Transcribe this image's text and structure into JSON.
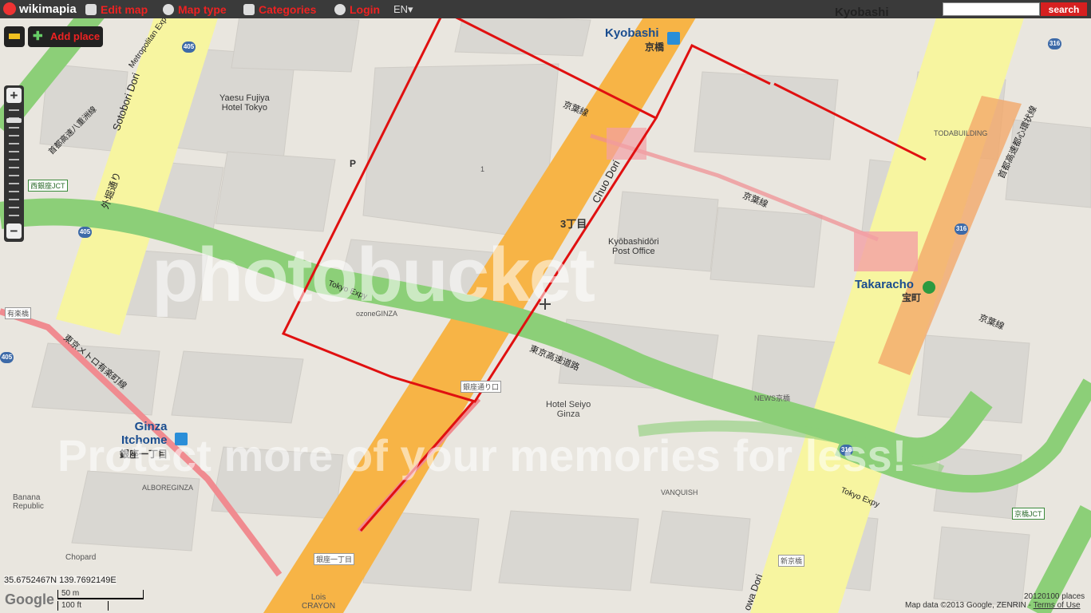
{
  "header": {
    "logo": "wikimapia",
    "edit_map": "Edit map",
    "map_type": "Map type",
    "categories": "Categories",
    "login": "Login",
    "language": "EN▾",
    "current_place": "Kyobashi",
    "search_placeholder": "",
    "search_button": "search"
  },
  "tools": {
    "add_place": "Add place",
    "zoom_in": "+",
    "zoom_out": "−"
  },
  "map": {
    "stations": {
      "kyobashi_en": "Kyobashi",
      "kyobashi_ja": "京橋",
      "takaracho_en": "Takaracho",
      "takaracho_ja": "宝町",
      "ginza_itchome_en": "Ginza\nItchome",
      "ginza_itchome_ja": "銀座一丁目"
    },
    "district": "3丁目",
    "roads": {
      "chuo_dori": "Chuo Dori",
      "sotobori_dori": "Sotobori Dori",
      "tokyo_expy": "Tokyo Expy",
      "tokyo_expy_ja": "東京高速道路",
      "keiyo_line_1": "京葉線",
      "keiyo_line_2": "京葉線",
      "keiyo_line_3": "京葉線",
      "metro_yurakucho": "東京メトロ有楽町線",
      "shuto_yaesu": "首都高速八重洲線",
      "sotobori_ja": "外堀通り",
      "metropolitan_exp": "Metropolitan Exp",
      "showa_dori": "owa Dori",
      "shuto_toshin": "首都高速都心環状線"
    },
    "junctions": {
      "nishiginza": "西銀座JCT",
      "kyobashi": "京橋JCT"
    },
    "pois": {
      "yaesu_fujiya": "Yaesu Fujiya\nHotel Tokyo",
      "kyobashidori_po": "Kyōbashidōri\nPost Office",
      "hotel_seiyo": "Hotel Seiyo\nGinza",
      "ginza_dori_guchi": "銀座通り口",
      "ginza_icchome_exit": "銀座一丁目",
      "todabuilding": "TODABUILDING",
      "banana_republic": "Banana\nRepublic",
      "chopard": "Chopard",
      "lois_crayon": "Lois\nCRAYON",
      "vanquish": "VANQUISH",
      "alboreginza": "ALBOREGINZA",
      "ozone_ginza": "ozoneGINZA",
      "news_kyobashi": "NEWS京橋",
      "shinkyobashi": "新京橋",
      "yurakubashi": "有楽橋",
      "block_1": "1",
      "kikkoman": "P"
    },
    "shields": [
      "405",
      "405",
      "405",
      "316",
      "316",
      "316"
    ],
    "coordinates": "35.6752467N 139.7692149E",
    "scale_metric": "50 m",
    "scale_imperial": "100 ft",
    "attribution": "Map data ©2013 Google, ZENRIN",
    "terms": "Terms of Use",
    "places_count": "20120100 places",
    "watermark_top": "photobucket",
    "watermark_bottom": "Protect more of your memories for less!",
    "colors": {
      "expressway": "#8ccf78",
      "arterial": "#f7b446",
      "secondary": "#f7f5a0",
      "outline": "#e01010",
      "rail": "#f08b90",
      "block": "#dcdad5",
      "street": "#ffffff"
    }
  }
}
